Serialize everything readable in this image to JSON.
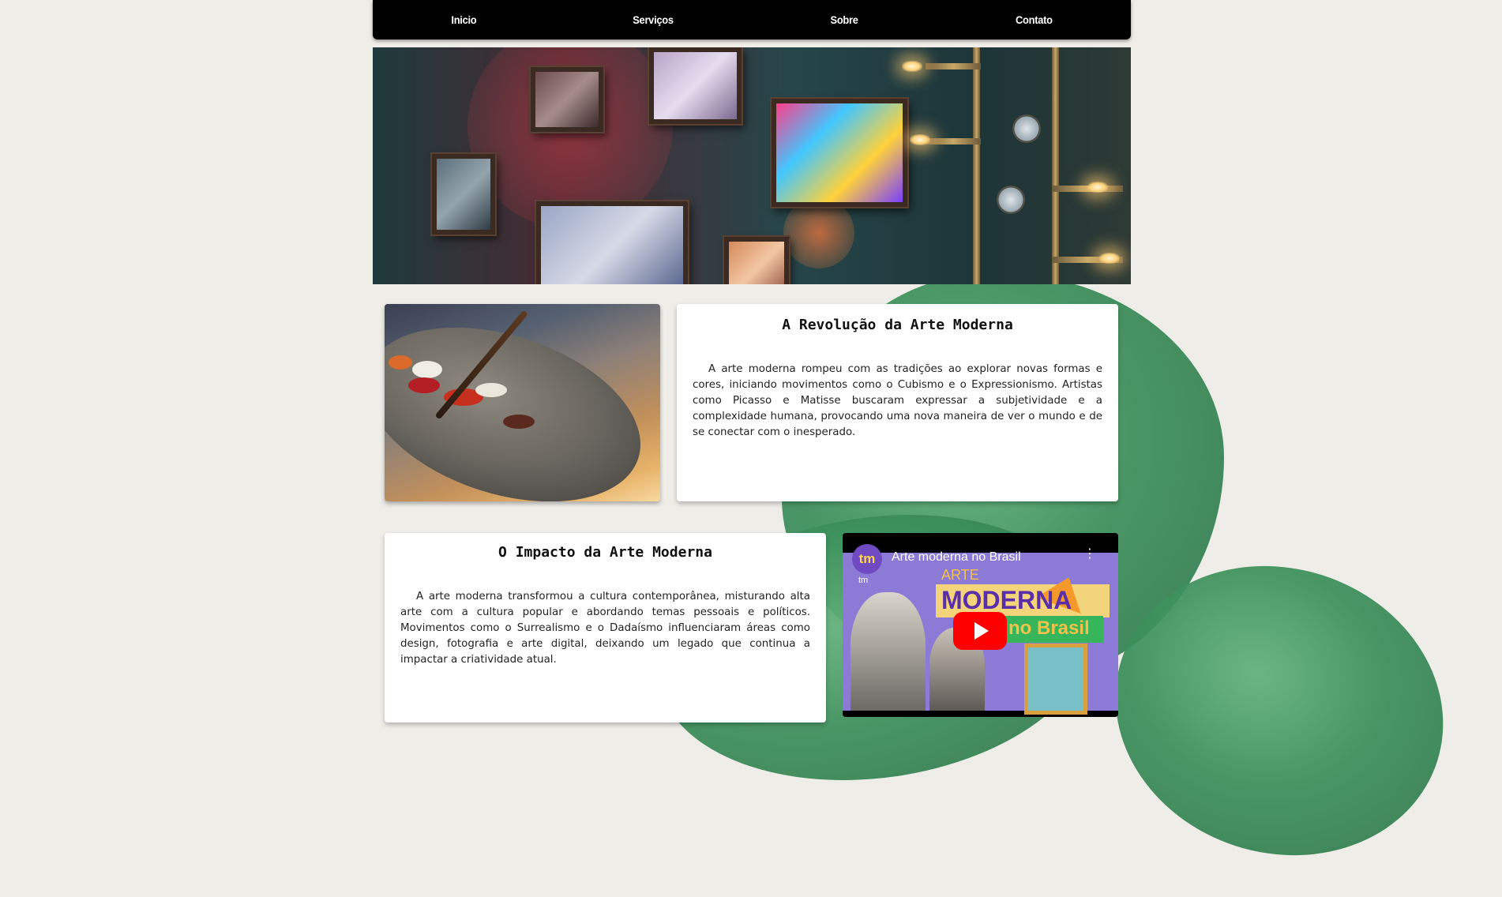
{
  "nav": {
    "items": [
      "Inicio",
      "Serviços",
      "Sobre",
      "Contato"
    ]
  },
  "article1": {
    "title": "A Revolução da Arte Moderna",
    "body": "A arte moderna rompeu com as tradições ao explorar novas formas e cores, iniciando movimentos como o Cubismo e o Expressionismo. Artistas como Picasso e Matisse buscaram expressar a subjetividade e a complexidade humana, provocando uma nova maneira de ver o mundo e de se conectar com o inesperado."
  },
  "article2": {
    "title": "O Impacto da Arte Moderna",
    "body": "A arte moderna transformou a cultura contemporânea, misturando alta arte com a cultura popular e abordando temas pessoais e políticos. Movimentos como o Surrealismo e o Dadaísmo influenciaram áreas como design, fotografia e arte digital, deixando um legado que continua a impactar a criatividade atual."
  },
  "video": {
    "title": "Arte moderna no Brasil",
    "channel_badge": "tm",
    "channel_badge_small": "tm",
    "thumb_word_1": "ARTE",
    "thumb_word_2": "MODERNA",
    "thumb_word_3": "no Brasil"
  },
  "colors": {
    "nav_bg": "#000000",
    "card_bg": "#ffffff",
    "page_bg": "#efede8",
    "leaf": "#3b8f5a",
    "youtube_red": "#ff0000"
  }
}
